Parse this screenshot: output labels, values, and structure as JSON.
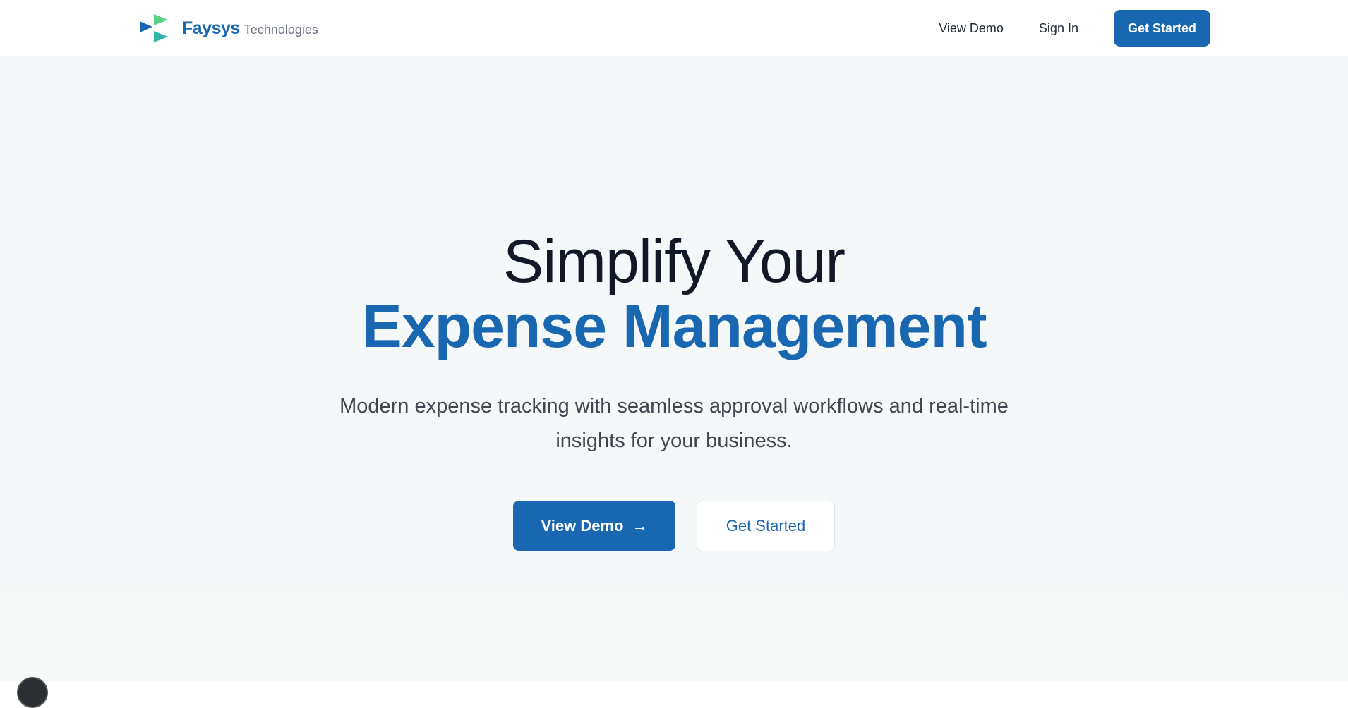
{
  "header": {
    "brand_name": "Faysys",
    "brand_sub": "Technologies",
    "nav": {
      "view_demo": "View Demo",
      "sign_in": "Sign In",
      "get_started": "Get Started"
    }
  },
  "hero": {
    "title_line1": "Simplify Your",
    "title_line2": "Expense Management",
    "subtitle": "Modern expense tracking with seamless approval workflows and real-time insights for your business.",
    "cta_primary": "View Demo",
    "cta_secondary": "Get Started"
  },
  "colors": {
    "brand_blue": "#1a67b1",
    "logo_green": "#5ed08a",
    "logo_teal": "#2fb8a8",
    "heading_dark": "#121826"
  },
  "icons": {
    "logo": "faysys-logo-icon",
    "cta_arrow": "arrow-right-icon"
  }
}
